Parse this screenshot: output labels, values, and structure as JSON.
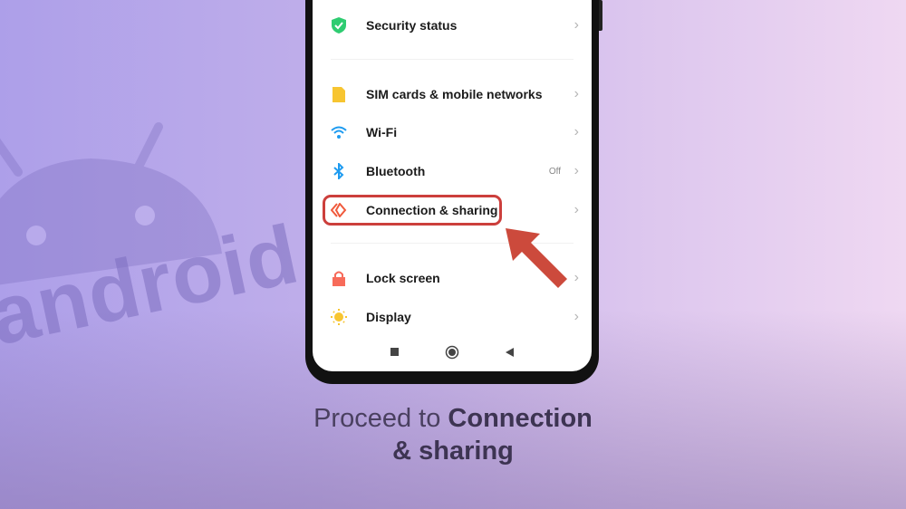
{
  "background_logo": {
    "word": "android",
    "color": "#7d6ec0"
  },
  "settings": {
    "items": [
      {
        "label": "Security status",
        "icon": "shield-check-icon",
        "color": "#2ecc71"
      },
      {
        "label": "SIM cards & mobile networks",
        "icon": "sim-card-icon",
        "color": "#f7c531"
      },
      {
        "label": "Wi-Fi",
        "icon": "wifi-icon",
        "color": "#1e9bf0"
      },
      {
        "label": "Bluetooth",
        "icon": "bluetooth-icon",
        "color": "#1e9bf0",
        "value": "Off"
      },
      {
        "label": "Connection & sharing",
        "icon": "connection-sharing-icon",
        "color": "#f05a3c",
        "highlighted": true
      },
      {
        "label": "Lock screen",
        "icon": "lock-icon",
        "color": "#f76b5a"
      },
      {
        "label": "Display",
        "icon": "sun-icon",
        "color": "#f7c531"
      }
    ]
  },
  "navbar": {
    "buttons": [
      "recents",
      "home",
      "back"
    ]
  },
  "highlight_color": "#cc3f3c",
  "caption": {
    "normal": "Proceed to ",
    "bold_1": "Connection",
    "bold_2": "& sharing"
  }
}
